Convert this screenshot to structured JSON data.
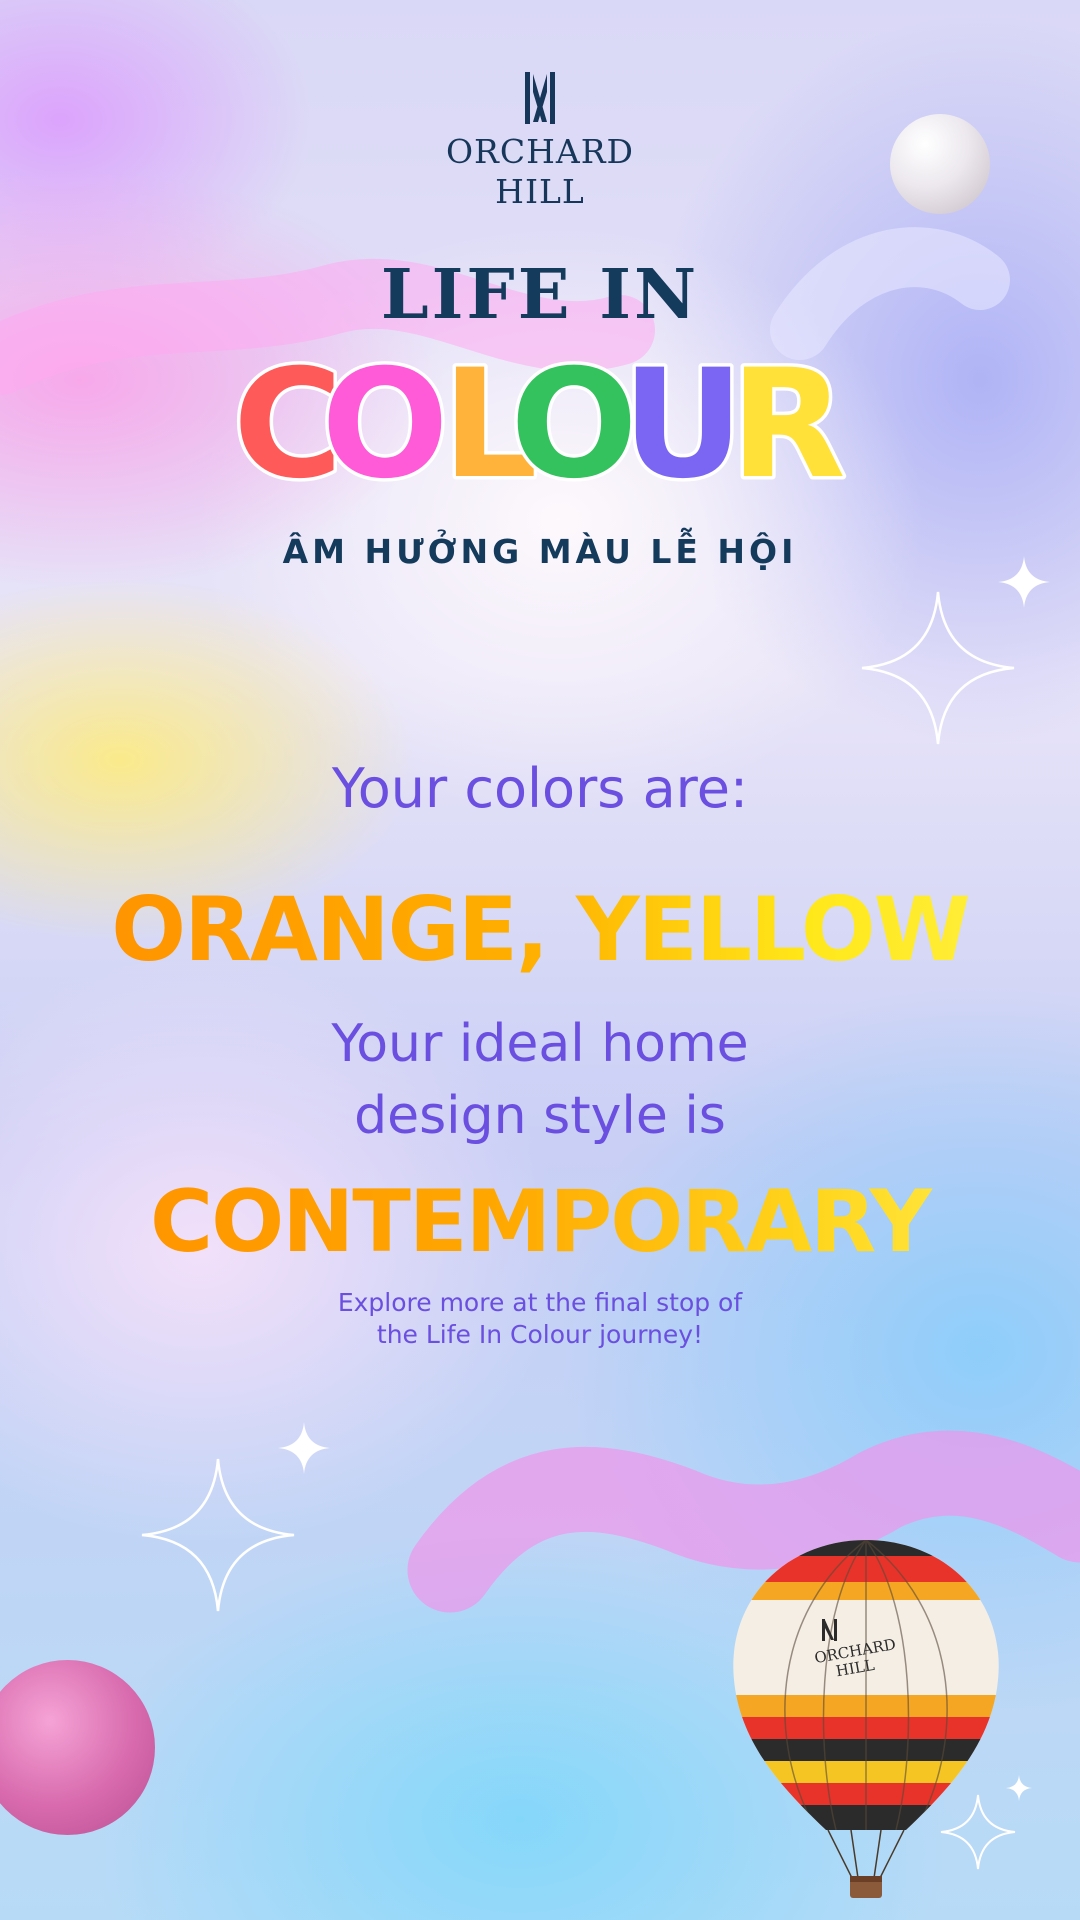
{
  "brand": {
    "line1": "ORCHARD",
    "line2": "HILL",
    "balloon_line1": "ORCHARD",
    "balloon_line2": "HILL"
  },
  "header": {
    "title_line1": "LIFE IN",
    "title_word": "COLOUR",
    "title_letters": [
      "C",
      "O",
      "L",
      "O",
      "U",
      "R"
    ],
    "letter_colors": [
      "#ff5a5a",
      "#ff5ad8",
      "#ffb33a",
      "#34c25e",
      "#7a66f2",
      "#ffe13a"
    ],
    "tagline": "ÂM HƯỞNG MÀU LỄ HỘI"
  },
  "result": {
    "colors_prompt": "Your colors are:",
    "colors_value": "ORANGE, YELLOW",
    "style_prompt_line1": "Your ideal home",
    "style_prompt_line2": "design style is",
    "style_value": "CONTEMPORARY",
    "explore_line1": "Explore more at the final stop of",
    "explore_line2": "the Life In Colour journey!"
  },
  "theme": {
    "navy": "#143a5c",
    "purple_text": "#6a4fe0",
    "orange": "#ff8d00",
    "yellow": "#ffe81a"
  },
  "icons": [
    "orchard-hill-logo-icon",
    "sparkle-star-icon",
    "hot-air-balloon-icon",
    "sphere-decoration"
  ]
}
